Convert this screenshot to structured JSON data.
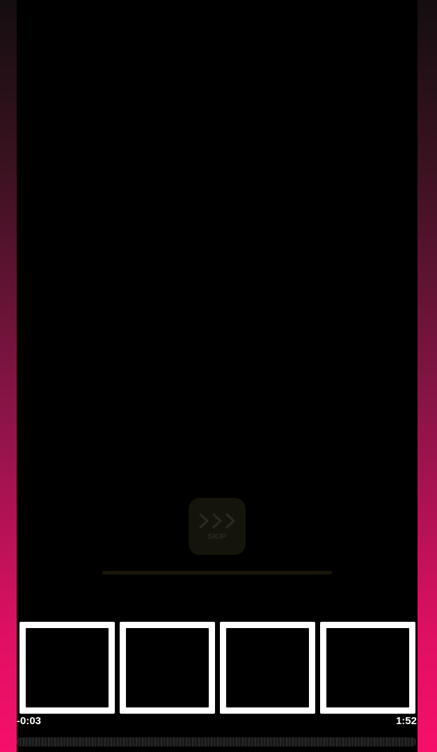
{
  "skip": {
    "label": "SKIP",
    "icon": "triple-chevron-right-icon"
  },
  "timeline": {
    "elapsed": "-0:03",
    "duration": "1:52"
  },
  "thumbnails": [
    {
      "name": "frame-1"
    },
    {
      "name": "frame-2"
    },
    {
      "name": "frame-3"
    },
    {
      "name": "frame-4"
    }
  ],
  "colors": {
    "edge_glow": "#f5106a",
    "background": "#000000",
    "skip_bg": "#15140a"
  }
}
